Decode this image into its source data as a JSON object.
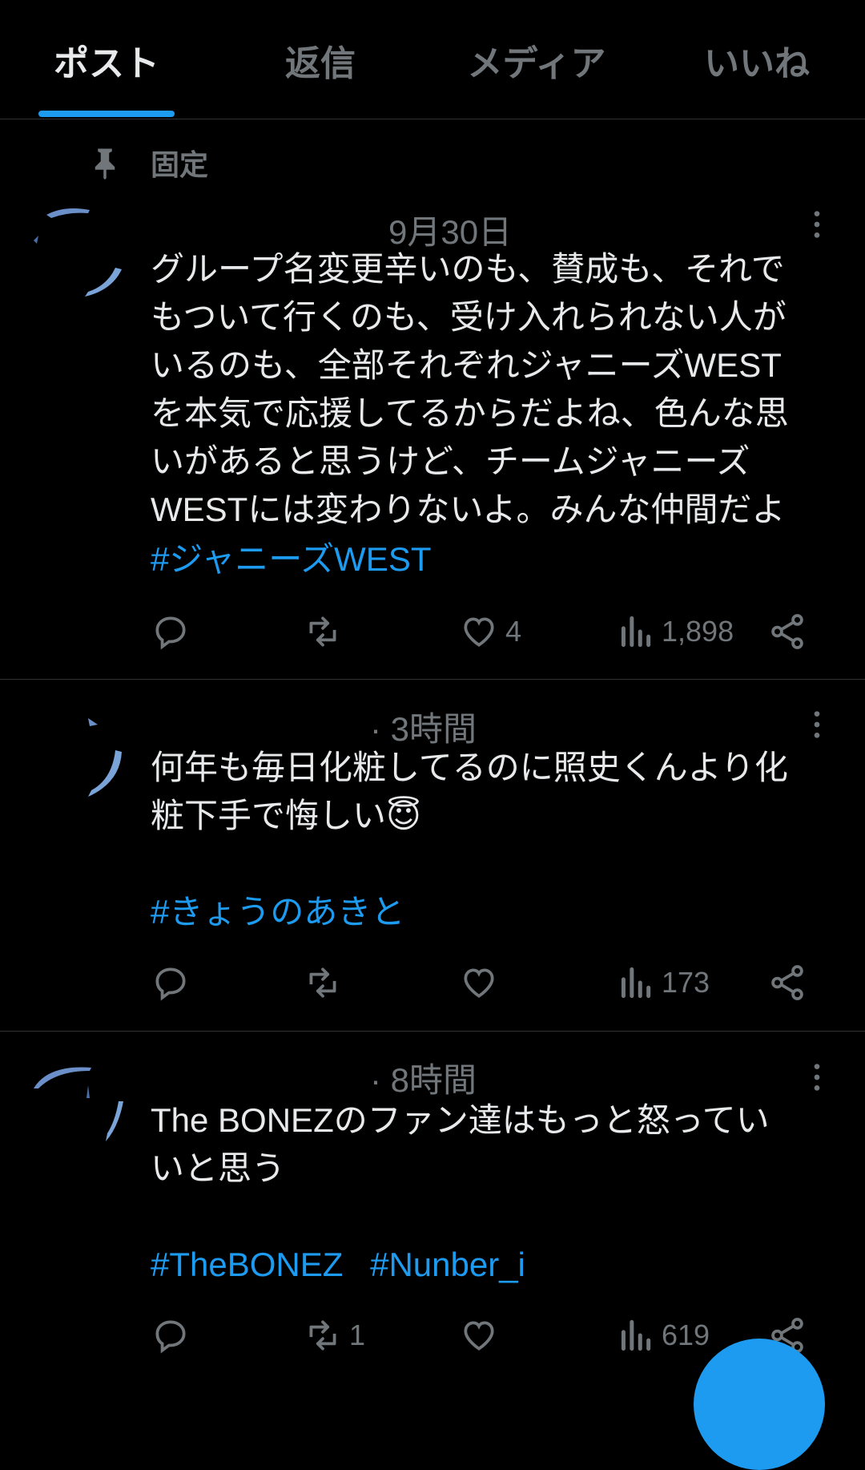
{
  "tabs": [
    {
      "label": "ポスト"
    },
    {
      "label": "返信"
    },
    {
      "label": "メディア"
    },
    {
      "label": "いいね"
    }
  ],
  "pinned_label": "固定",
  "posts": [
    {
      "meta": "9月30日",
      "text": "グループ名変更辛いのも、賛成も、それで\nもついて行くのも、受け入れられない人が\nいるのも、全部それぞれジャニーズWEST\nを本気で応援してるからだよね、色んな思\nいがあると思うけど、チームジャニーズ\nWESTには変わりないよ。みんな仲間だよ",
      "hashtags": [
        "#ジャニーズWEST"
      ],
      "reply_count": "",
      "repost_count": "",
      "like_count": "4",
      "view_count": "1,898"
    },
    {
      "meta": "· 3時間",
      "text": "何年も毎日化粧してるのに照史くんより化\n粧下手で悔しい😇",
      "hashtags": [
        "#きょうのあきと"
      ],
      "reply_count": "",
      "repost_count": "",
      "like_count": "",
      "view_count": "173"
    },
    {
      "meta": "· 8時間",
      "text": "The BONEZのファン達はもっと怒ってい\nいと思う",
      "hashtags": [
        "#TheBONEZ",
        "#Nunber_i"
      ],
      "reply_count": "",
      "repost_count": "1",
      "like_count": "",
      "view_count": "619"
    }
  ],
  "icons": {
    "pin": "pin-icon",
    "more": "more-icon",
    "reply": "reply-icon",
    "repost": "repost-icon",
    "like": "heart-icon",
    "views": "views-icon",
    "share": "share-icon"
  },
  "colors": {
    "background": "#000000",
    "text": "#e7e9ea",
    "muted": "#71767b",
    "accent": "#1d9bf0",
    "divider": "#2f3336"
  }
}
